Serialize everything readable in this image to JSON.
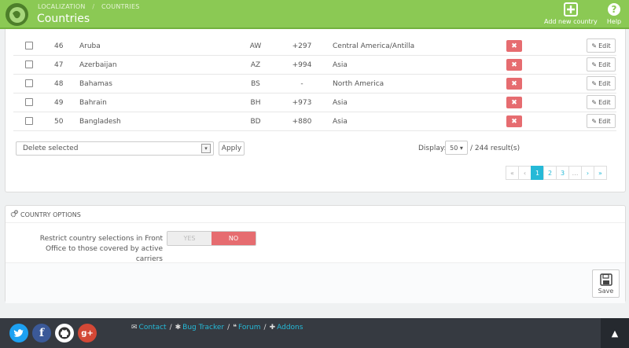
{
  "header": {
    "breadcrumb": [
      "LOCALIZATION",
      "COUNTRIES"
    ],
    "title": "Countries",
    "add_label": "Add new country",
    "help_label": "Help"
  },
  "table": {
    "rows": [
      {
        "id": "46",
        "name": "Aruba",
        "iso": "AW",
        "call_prefix": "+297",
        "zone": "Central America/Antilla"
      },
      {
        "id": "47",
        "name": "Azerbaijan",
        "iso": "AZ",
        "call_prefix": "+994",
        "zone": "Asia"
      },
      {
        "id": "48",
        "name": "Bahamas",
        "iso": "BS",
        "call_prefix": "-",
        "zone": "North America"
      },
      {
        "id": "49",
        "name": "Bahrain",
        "iso": "BH",
        "call_prefix": "+973",
        "zone": "Asia"
      },
      {
        "id": "50",
        "name": "Bangladesh",
        "iso": "BD",
        "call_prefix": "+880",
        "zone": "Asia"
      }
    ],
    "edit_label": "Edit",
    "delete_label": "✖"
  },
  "bulk": {
    "selected": "Delete selected",
    "apply_label": "Apply"
  },
  "display": {
    "label": "Display:",
    "per_page": "50 ▾",
    "results": "/ 244 result(s)"
  },
  "pagination": {
    "first": "«",
    "prev": "‹",
    "pages": [
      "1",
      "2",
      "3",
      "…"
    ],
    "next": "›",
    "last": "»"
  },
  "options": {
    "heading": "COUNTRY OPTIONS",
    "restrict_label": "Restrict country selections in Front Office to those covered by active carriers",
    "yes_label": "YES",
    "no_label": "NO",
    "selected": "NO",
    "save_label": "Save"
  },
  "footer": {
    "links": [
      "Contact",
      "Bug Tracker",
      "Forum",
      "Addons"
    ]
  },
  "colors": {
    "header_green": "#8bc954",
    "accent_blue": "#25b9d7",
    "danger_red": "#e66c70",
    "footer_dark": "#363a41"
  }
}
